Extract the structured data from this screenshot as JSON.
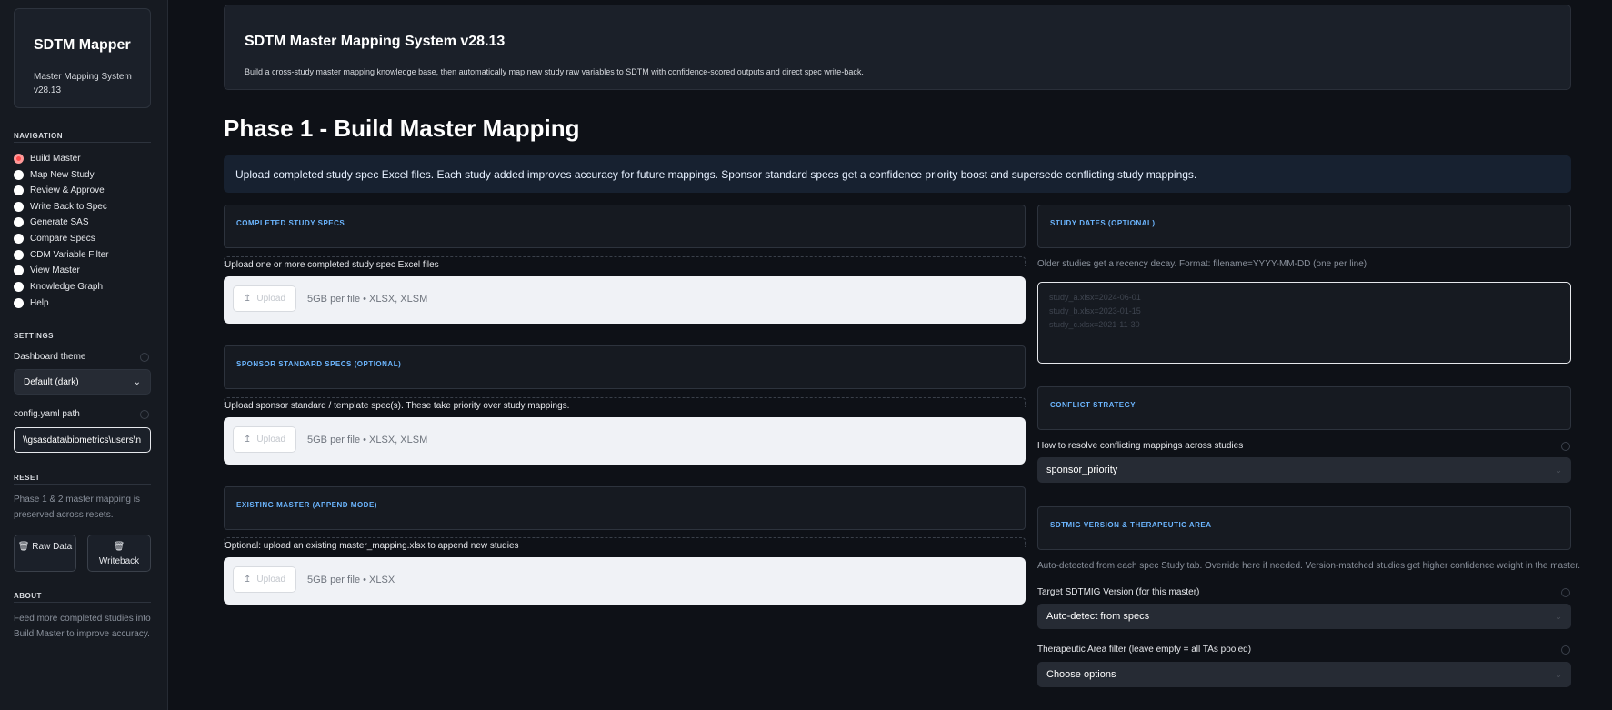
{
  "sidebar": {
    "app_title": "SDTM Mapper",
    "app_subtitle": "Master Mapping System v28.13",
    "navigation_heading": "NAVIGATION",
    "nav_items": [
      {
        "label": "Build Master"
      },
      {
        "label": "Map New Study"
      },
      {
        "label": "Review & Approve"
      },
      {
        "label": "Write Back to Spec"
      },
      {
        "label": "Generate SAS"
      },
      {
        "label": "Compare Specs"
      },
      {
        "label": "CDM Variable Filter"
      },
      {
        "label": "View Master"
      },
      {
        "label": "Knowledge Graph"
      },
      {
        "label": "Help"
      }
    ],
    "selected_nav": "Build Master",
    "settings_heading": "SETTINGS",
    "theme_label": "Dashboard theme",
    "theme_value": "Default (dark)",
    "config_label": "config.yaml path",
    "config_value": "\\\\gsasdata\\biometrics\\users\\n",
    "reset_heading": "RESET",
    "reset_note": "Phase 1 & 2 master mapping is preserved across resets.",
    "reset_raw_label": "Raw Data",
    "reset_writeback_label": "Writeback",
    "about_heading": "ABOUT",
    "about_text": "Feed more completed studies into Build Master to improve accuracy."
  },
  "header": {
    "title": "SDTM Master Mapping System v28.13",
    "subtitle": "Build a cross-study master mapping knowledge base, then automatically map new study raw variables to SDTM with confidence-scored outputs and direct spec write-back."
  },
  "main": {
    "page_title": "Phase 1 - Build Master Mapping",
    "info_banner": "Upload completed study spec Excel files. Each study added improves accuracy for future mappings. Sponsor standard specs get a confidence priority boost and supersede conflicting study mappings.",
    "completed_specs": {
      "title": "COMPLETED STUDY SPECS",
      "uploader_label": "Upload one or more completed study spec Excel files",
      "button": "Upload",
      "hint": "5GB per file • XLSX, XLSM"
    },
    "sponsor_specs": {
      "title": "SPONSOR STANDARD SPECS (OPTIONAL)",
      "uploader_label": "Upload sponsor standard / template spec(s). These take priority over study mappings.",
      "button": "Upload",
      "hint": "5GB per file • XLSX, XLSM"
    },
    "existing_master": {
      "title": "EXISTING MASTER (APPEND MODE)",
      "uploader_label": "Optional: upload an existing master_mapping.xlsx to append new studies",
      "button": "Upload",
      "hint": "5GB per file • XLSX"
    },
    "study_dates": {
      "title": "STUDY DATES (OPTIONAL)",
      "help": "Older studies get a recency decay. Format: filename=YYYY-MM-DD (one per line)",
      "placeholder": "study_a.xlsx=2024-06-01\nstudy_b.xlsx=2023-01-15\nstudy_c.xlsx=2021-11-30"
    },
    "conflict": {
      "title": "CONFLICT STRATEGY",
      "label": "How to resolve conflicting mappings across studies",
      "value": "sponsor_priority"
    },
    "sdtmig": {
      "title": "SDTMIG VERSION & THERAPEUTIC AREA",
      "help": "Auto-detected from each spec Study tab. Override here if needed. Version-matched studies get higher confidence weight in the master.",
      "version_label": "Target SDTMIG Version (for this master)",
      "version_value": "Auto-detect from specs",
      "ta_label": "Therapeutic Area filter (leave empty = all TAs pooled)",
      "ta_value": "Choose options"
    }
  },
  "icons": {
    "upload": "upload-icon",
    "trash": "trash-icon",
    "chevron": "chevron-down-icon",
    "help": "help-icon"
  },
  "colors": {
    "accent_radio": "#ff4b4b",
    "section_title": "#6cb6ff",
    "info_banner_bg": "#172130"
  }
}
